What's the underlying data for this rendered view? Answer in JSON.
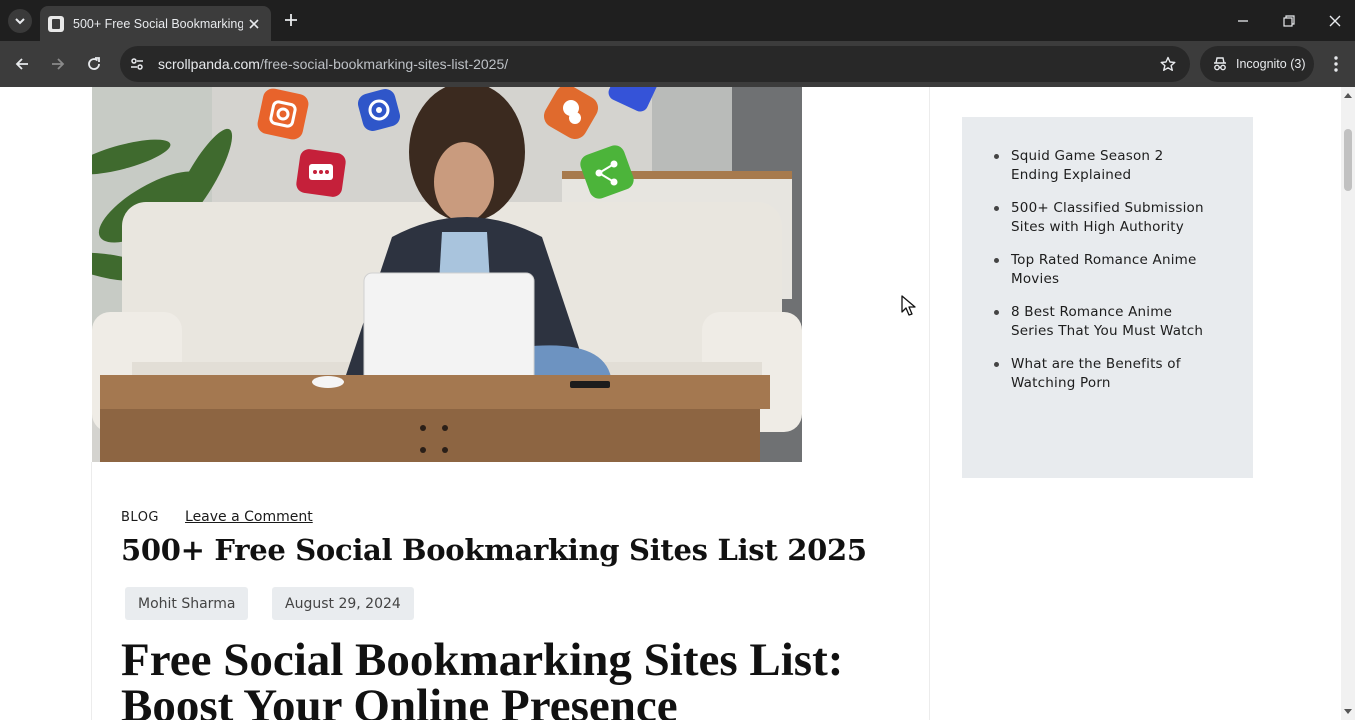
{
  "browser": {
    "tab": {
      "title": "500+ Free Social Bookmarking"
    },
    "url": {
      "domain": "scrollpanda.com",
      "path": "/free-social-bookmarking-sites-list-2025/"
    },
    "incognito_label": "Incognito (3)"
  },
  "article": {
    "category": "BLOG",
    "comment_link": "Leave a Comment",
    "title": "500+ Free Social Bookmarking Sites List 2025",
    "author": "Mohit Sharma",
    "date": "August 29, 2024",
    "heading": "Free Social Bookmarking Sites List: Boost Your Online Presence"
  },
  "sidebar": {
    "items": [
      {
        "label": "Squid Game Season 2 Ending Explained"
      },
      {
        "label": "500+ Classified Submission Sites with High Authority"
      },
      {
        "label": "Top Rated Romance Anime Movies"
      },
      {
        "label": "8 Best Romance Anime Series That You Must Watch"
      },
      {
        "label": "What are the Benefits of Watching Porn"
      }
    ]
  },
  "hero_image": {
    "icons": [
      "instagram-icon",
      "email-icon",
      "chat-icon",
      "share-icon",
      "user-icon"
    ],
    "colors": {
      "orange": "#e8632b",
      "blue": "#2f56c9",
      "red": "#c5203a",
      "green": "#4cb43a"
    }
  },
  "colors": {
    "chrome_dark": "#1f1f1f",
    "chrome_toolbar": "#3c3c3c",
    "widget_bg": "#e8ebee",
    "chip_bg": "#e9ecef"
  }
}
